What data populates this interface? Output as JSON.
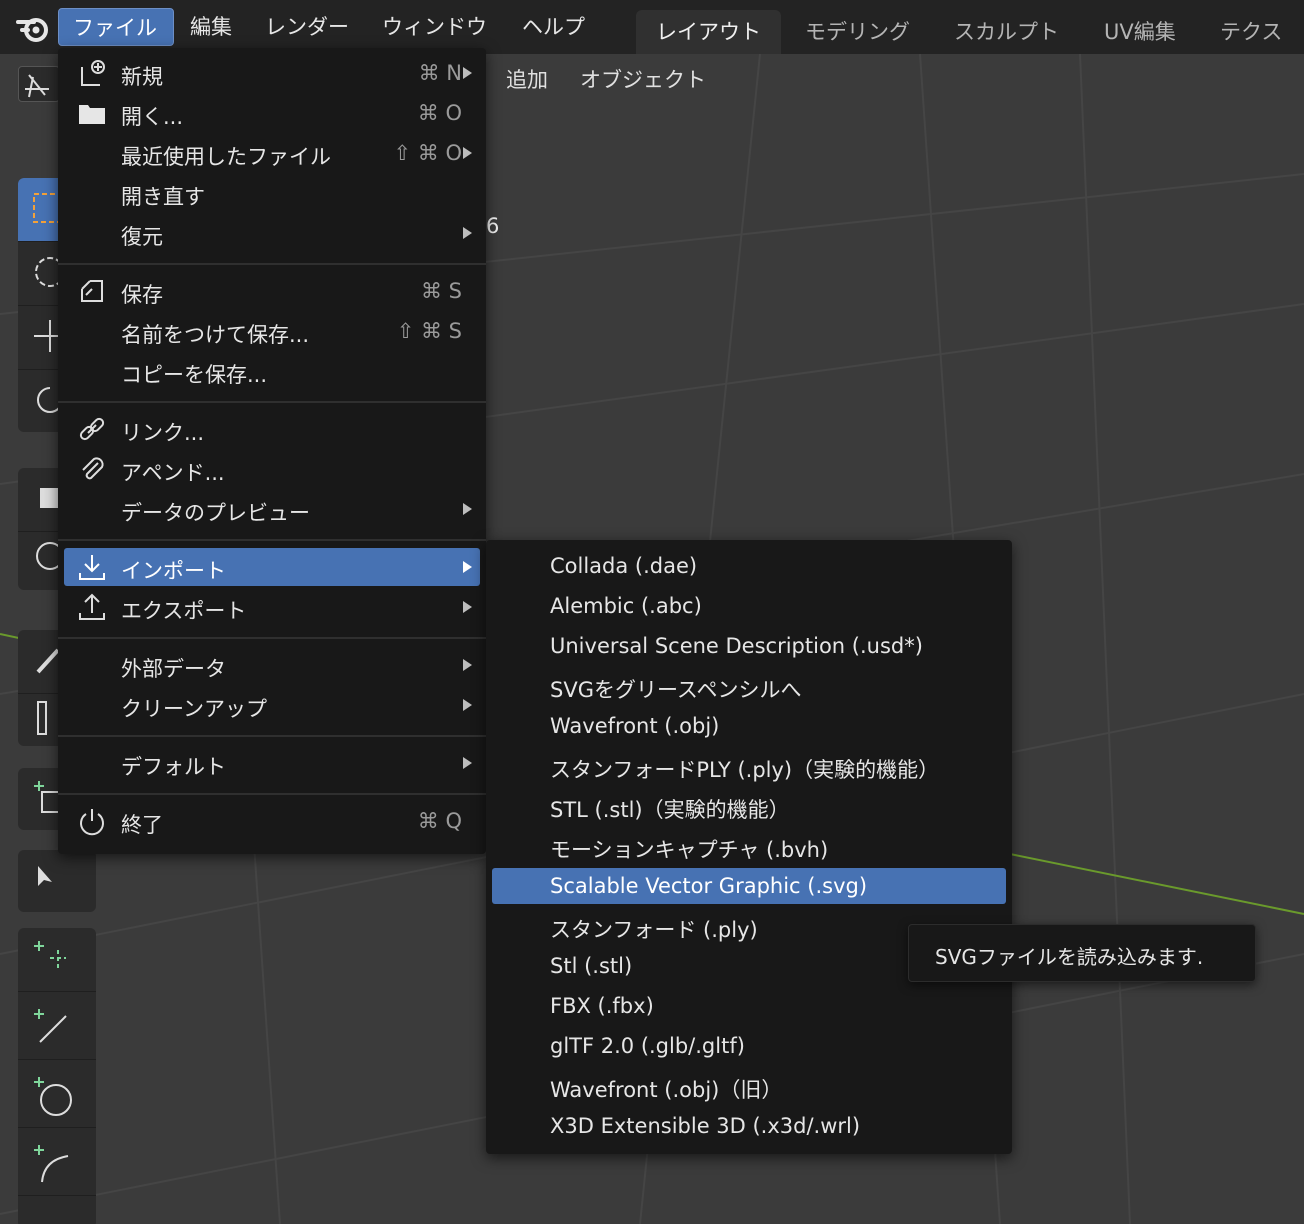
{
  "topbar": {
    "menus": [
      "ファイル",
      "編集",
      "レンダー",
      "ウィンドウ",
      "ヘルプ"
    ],
    "workspaces": [
      "レイアウト",
      "モデリング",
      "スカルプト",
      "UV編集",
      "テクスチ"
    ]
  },
  "viewport": {
    "menus": [
      "追加",
      "オブジェクト"
    ],
    "frame_number": "6"
  },
  "file_menu": {
    "items": [
      {
        "label": "新規",
        "shortcut": "⌘ N",
        "icon": "new-file-icon",
        "submenu": true
      },
      {
        "label": "開く...",
        "shortcut": "⌘ O",
        "icon": "folder-icon",
        "submenu": false
      },
      {
        "label": "最近使用したファイル",
        "shortcut": "⇧ ⌘ O",
        "icon": "",
        "submenu": true
      },
      {
        "label": "開き直す",
        "shortcut": "",
        "icon": "",
        "submenu": false
      },
      {
        "label": "復元",
        "shortcut": "",
        "icon": "",
        "submenu": true
      },
      {
        "label": "保存",
        "shortcut": "⌘ S",
        "icon": "save-icon",
        "submenu": false
      },
      {
        "label": "名前をつけて保存...",
        "shortcut": "⇧ ⌘ S",
        "icon": "",
        "submenu": false
      },
      {
        "label": "コピーを保存...",
        "shortcut": "",
        "icon": "",
        "submenu": false
      },
      {
        "label": "リンク...",
        "shortcut": "",
        "icon": "link-icon",
        "submenu": false
      },
      {
        "label": "アペンド...",
        "shortcut": "",
        "icon": "paperclip-icon",
        "submenu": false
      },
      {
        "label": "データのプレビュー",
        "shortcut": "",
        "icon": "",
        "submenu": true
      },
      {
        "label": "インポート",
        "shortcut": "",
        "icon": "import-icon",
        "submenu": true,
        "active": true
      },
      {
        "label": "エクスポート",
        "shortcut": "",
        "icon": "export-icon",
        "submenu": true
      },
      {
        "label": "外部データ",
        "shortcut": "",
        "icon": "",
        "submenu": true
      },
      {
        "label": "クリーンアップ",
        "shortcut": "",
        "icon": "",
        "submenu": true
      },
      {
        "label": "デフォルト",
        "shortcut": "",
        "icon": "",
        "submenu": true
      },
      {
        "label": "終了",
        "shortcut": "⌘ Q",
        "icon": "power-icon",
        "submenu": false
      }
    ]
  },
  "import_menu": {
    "items": [
      "Collada (.dae)",
      "Alembic (.abc)",
      "Universal Scene Description (.usd*)",
      "SVGをグリースペンシルへ",
      "Wavefront (.obj)",
      "スタンフォードPLY (.ply)（実験的機能）",
      "STL (.stl)（実験的機能）",
      "モーションキャプチャ (.bvh)",
      "Scalable Vector Graphic (.svg)",
      "スタンフォード (.ply)",
      "Stl (.stl)",
      "FBX (.fbx)",
      "glTF 2.0 (.glb/.gltf)",
      "Wavefront (.obj)（旧）",
      "X3D Extensible 3D (.x3d/.wrl)"
    ],
    "active_index": 8
  },
  "tooltip": {
    "text": "SVGファイルを読み込みます."
  },
  "colors": {
    "accent": "#4772b3",
    "menu_bg": "#181818",
    "axis_green": "#6a9a2c",
    "axis_red": "#a0403f"
  }
}
